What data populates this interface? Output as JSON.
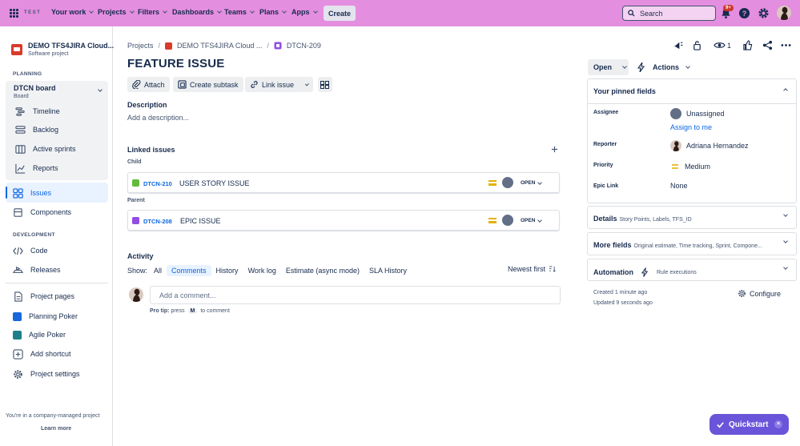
{
  "topbar": {
    "logo": "TEST",
    "nav": [
      {
        "label": "Your work"
      },
      {
        "label": "Projects"
      },
      {
        "label": "Filters"
      },
      {
        "label": "Dashboards"
      },
      {
        "label": "Teams"
      },
      {
        "label": "Plans"
      },
      {
        "label": "Apps"
      }
    ],
    "create_label": "Create",
    "search_placeholder": "Search",
    "notifications_badge": "9+",
    "bg_color": "#e48ee0"
  },
  "sidebar": {
    "project_name": "DEMO TFS4JIRA Cloud...",
    "project_type": "Software project",
    "planning_heading": "PLANNING",
    "board_title": "DTCN board",
    "board_sub": "Board",
    "planning_items": [
      {
        "label": "Timeline",
        "icon": "timeline-icon"
      },
      {
        "label": "Backlog",
        "icon": "backlog-icon"
      },
      {
        "label": "Active sprints",
        "icon": "sprints-icon"
      },
      {
        "label": "Reports",
        "icon": "reports-icon"
      }
    ],
    "issues_label": "Issues",
    "components_label": "Components",
    "development_heading": "DEVELOPMENT",
    "code_label": "Code",
    "releases_label": "Releases",
    "bottom_items": [
      {
        "label": "Project pages"
      },
      {
        "label": "Planning Poker"
      },
      {
        "label": "Agile Poker"
      },
      {
        "label": "Add shortcut"
      },
      {
        "label": "Project settings"
      }
    ],
    "managed_text": "You're in a company-managed project",
    "learn_more": "Learn more"
  },
  "breadcrumb": {
    "root": "Projects",
    "project": "DEMO TFS4JIRA Cloud ...",
    "issue_key": "DTCN-209"
  },
  "issue": {
    "title": "FEATURE ISSUE",
    "toolbar": {
      "attach": "Attach",
      "create_subtask": "Create subtask",
      "link_issue": "Link issue"
    },
    "description_heading": "Description",
    "description_placeholder": "Add a description...",
    "linked_heading": "Linked issues",
    "child_label": "Child",
    "parent_label": "Parent",
    "linked": [
      {
        "key": "DTCN-210",
        "summary": "USER STORY ISSUE",
        "status": "OPEN",
        "type_color": "#63ba3c"
      },
      {
        "key": "DTCN-208",
        "summary": "EPIC ISSUE",
        "status": "OPEN",
        "type_color": "#904ee2"
      }
    ]
  },
  "activity": {
    "heading": "Activity",
    "show_label": "Show:",
    "tabs": [
      "All",
      "Comments",
      "History",
      "Work log",
      "Estimate (async mode)",
      "SLA History"
    ],
    "active_tab": "Comments",
    "sort_label": "Newest first",
    "comment_placeholder": "Add a comment...",
    "tip_prefix": "Pro tip:",
    "tip_press": "press",
    "tip_key": "M",
    "tip_suffix": "to comment"
  },
  "right": {
    "watchers_count": "1",
    "status": "Open",
    "actions_label": "Actions",
    "pinned_heading": "Your pinned fields",
    "fields": {
      "assignee_label": "Assignee",
      "assignee_value": "Unassigned",
      "assign_to_me": "Assign to me",
      "reporter_label": "Reporter",
      "reporter_value": "Adriana Hernandez",
      "priority_label": "Priority",
      "priority_value": "Medium",
      "epic_label": "Epic Link",
      "epic_value": "None"
    },
    "details_heading": "Details",
    "details_sub": "Story Points, Labels, TFS_ID",
    "more_heading": "More fields",
    "more_sub": "Original estimate, Time tracking, Sprint, Compone...",
    "automation_heading": "Automation",
    "automation_sub": "Rule executions",
    "created": "Created 1 minute ago",
    "updated": "Updated 9 seconds ago",
    "configure": "Configure"
  },
  "quickstart": {
    "label": "Quickstart",
    "color": "#6a54d9"
  }
}
